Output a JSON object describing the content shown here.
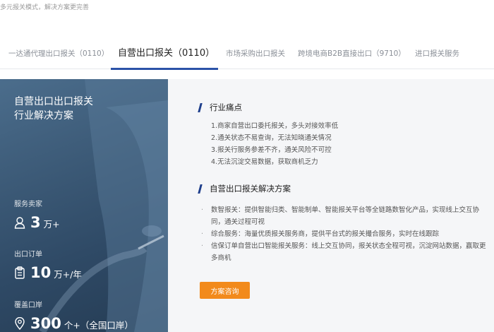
{
  "header": {
    "subtitle": "多元报关模式，解决方案更完善"
  },
  "tabs": [
    {
      "label": "一达通代理出口报关（0110）",
      "active": false
    },
    {
      "label": "自营出口报关（0110）",
      "active": true
    },
    {
      "label": "市场采购出口报关",
      "active": false
    },
    {
      "label": "跨境电商B2B直接出口（9710）",
      "active": false
    },
    {
      "label": "进口报关服务",
      "active": false
    }
  ],
  "hero": {
    "title_line1": "自营出口出口报关",
    "title_line2": "行业解决方案",
    "stats": [
      {
        "label": "服务卖家",
        "icon": "user-icon",
        "value": "3",
        "unit": "万+"
      },
      {
        "label": "出口订单",
        "icon": "clipboard-icon",
        "value": "10",
        "unit": "万+/年"
      },
      {
        "label": "覆盖口岸",
        "icon": "location-pin-icon",
        "value": "300",
        "unit": "个+（全国口岸）"
      }
    ]
  },
  "pain_points": {
    "title": "行业痛点",
    "items": [
      "1.商家自营出口委托报关，多头对接效率低",
      "2.通关状态不易查询，无法知晓通关情况",
      "3.报关行服务参差不齐，通关风险不可控",
      "4.无法沉淀交易数据，获取商机乏力"
    ]
  },
  "solution": {
    "title": "自营出口报关解决方案",
    "items": [
      "数智报关：提供智能归类、智能制单、智能报关平台等全链路数智化产品，实现线上交互协同，通关过程可视",
      "综合服务：海量优质报关服务商，提供平台式的报关撮合服务，实时在线跟踪",
      "信保订单自营出口智能报关服务：线上交互协同，报关状态全程可视，沉淀网站数据，赢取更多商机"
    ]
  },
  "cta": {
    "label": "方案咨询"
  },
  "colors": {
    "accent": "#2b52a8",
    "cta": "#f28a1c",
    "panel_bg": "#f5f6f8"
  }
}
